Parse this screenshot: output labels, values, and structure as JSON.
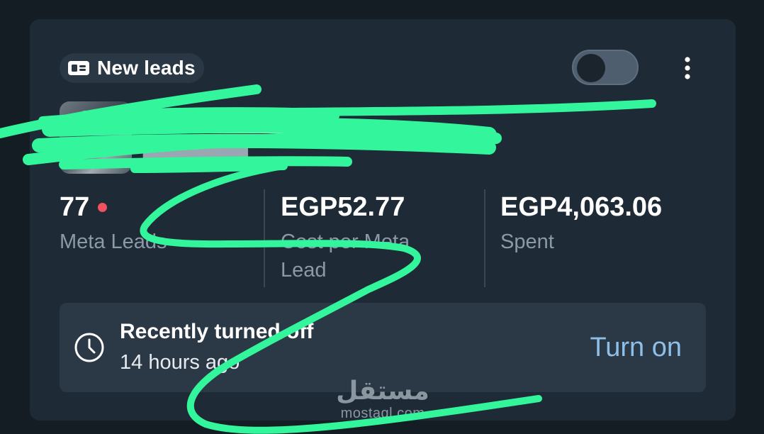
{
  "campaign": {
    "objective_label": "New leads",
    "objective_icon": "lead-card-icon",
    "active": false
  },
  "metrics": [
    {
      "value": "77",
      "label": "Meta Leads",
      "indicator_color": "#f0525e"
    },
    {
      "value": "EGP52.77",
      "label": "Cost per Meta Lead"
    },
    {
      "value": "EGP4,063.06",
      "label": "Spent"
    }
  ],
  "status": {
    "title": "Recently turned off",
    "time": "14 hours ago",
    "action_label": "Turn on",
    "icon": "clock-icon"
  },
  "watermark": {
    "arabic": "مستقل",
    "latin": "mostaql.com"
  },
  "colors": {
    "accent": "#8fbfe6",
    "card_bg": "#1e2a35",
    "scribble": "#33f59b"
  }
}
